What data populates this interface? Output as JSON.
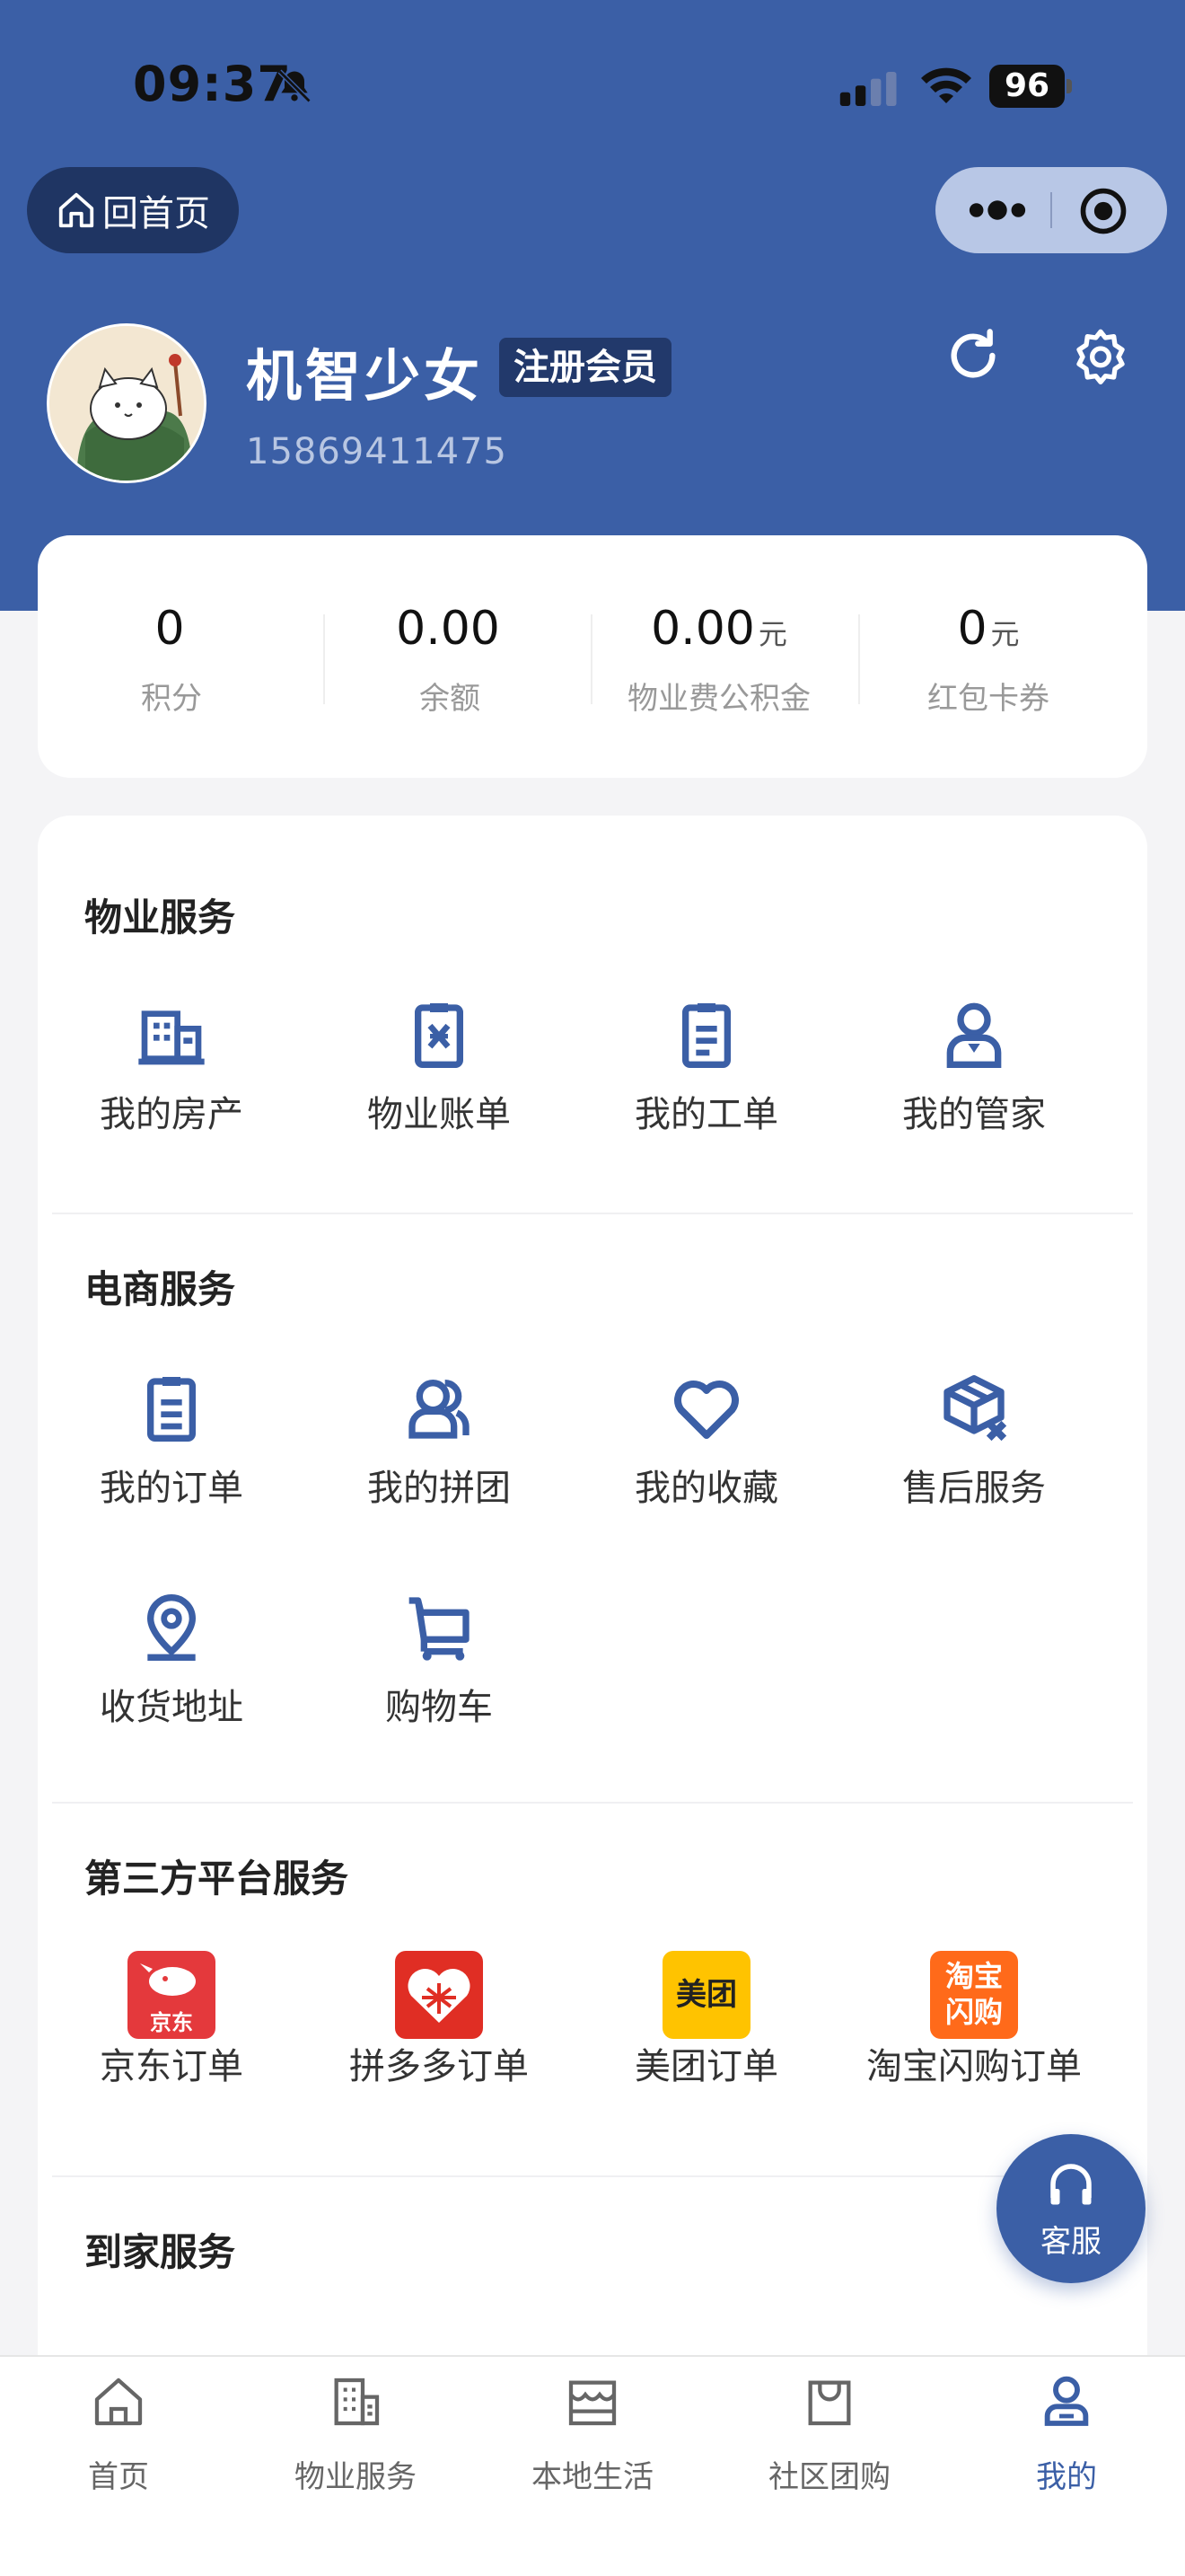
{
  "status_bar": {
    "time": "09:37",
    "battery": "96"
  },
  "nav": {
    "home_label": "回首页"
  },
  "profile": {
    "name": "机智少女",
    "badge": "注册会员",
    "phone": "15869411475"
  },
  "stats": [
    {
      "value": "0",
      "unit": "",
      "label": "积分"
    },
    {
      "value": "0.00",
      "unit": "",
      "label": "余额"
    },
    {
      "value": "0.00",
      "unit": "元",
      "label": "物业费公积金"
    },
    {
      "value": "0",
      "unit": "元",
      "label": "红包卡券"
    }
  ],
  "sections": {
    "property": {
      "title": "物业服务",
      "items": [
        {
          "label": "我的房产",
          "icon": "building-icon"
        },
        {
          "label": "物业账单",
          "icon": "bill-icon"
        },
        {
          "label": "我的工单",
          "icon": "work-order-icon"
        },
        {
          "label": "我的管家",
          "icon": "butler-icon"
        }
      ]
    },
    "ecommerce": {
      "title": "电商服务",
      "items": [
        {
          "label": "我的订单",
          "icon": "order-icon"
        },
        {
          "label": "我的拼团",
          "icon": "group-buy-icon"
        },
        {
          "label": "我的收藏",
          "icon": "heart-icon"
        },
        {
          "label": "售后服务",
          "icon": "after-sales-icon"
        },
        {
          "label": "收货地址",
          "icon": "location-icon"
        },
        {
          "label": "购物车",
          "icon": "cart-icon"
        }
      ]
    },
    "third_party": {
      "title": "第三方平台服务",
      "items": [
        {
          "label": "京东订单",
          "logo_text": "京东",
          "color": "#e4393c"
        },
        {
          "label": "拼多多订单",
          "logo_text": "",
          "color": "#e02e24"
        },
        {
          "label": "美团订单",
          "logo_text": "美团",
          "color": "#ffc300"
        },
        {
          "label": "淘宝闪购订单",
          "logo_text": "淘宝闪购",
          "color": "#ff6a1a"
        }
      ]
    },
    "home_service": {
      "title": "到家服务"
    }
  },
  "customer_service": {
    "label": "客服"
  },
  "tabbar": [
    {
      "label": "首页",
      "icon": "home-icon"
    },
    {
      "label": "物业服务",
      "icon": "office-building-icon"
    },
    {
      "label": "本地生活",
      "icon": "shop-icon"
    },
    {
      "label": "社区团购",
      "icon": "shopping-bag-icon"
    },
    {
      "label": "我的",
      "icon": "user-icon"
    }
  ],
  "colors": {
    "brand": "#3b5fa6",
    "brand_dark": "#1f3563"
  }
}
